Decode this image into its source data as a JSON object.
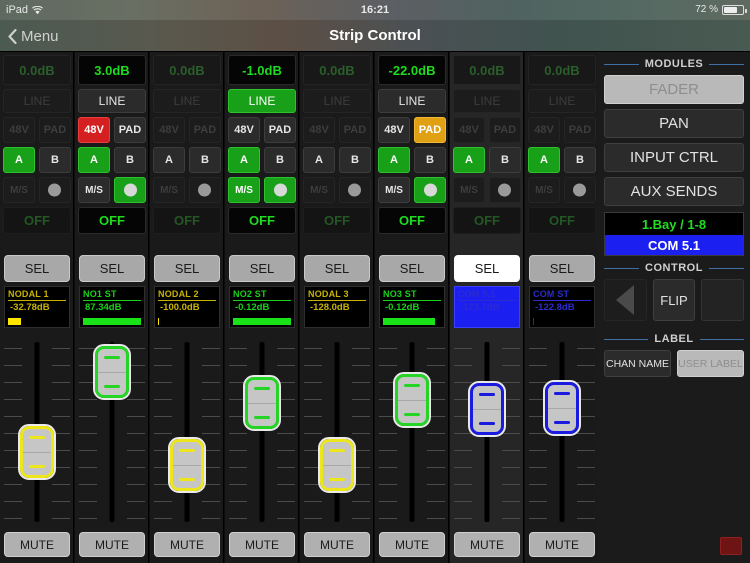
{
  "statusbar": {
    "device": "iPad",
    "wifi_icon": "wifi-icon",
    "time": "16:21",
    "battery_percent": "72 %",
    "battery_icon": "battery-icon"
  },
  "navbar": {
    "back_label": "Menu",
    "back_icon": "chevron-left-icon",
    "title": "Strip Control"
  },
  "strips": [
    {
      "gain": "0.0dB",
      "gain_state": "dim",
      "line_label": "LINE",
      "line_state": "dim",
      "p48_label": "48V",
      "p48_state": "dim",
      "pad_label": "PAD",
      "pad_state": "dim",
      "a_label": "A",
      "a_state": "green",
      "b_label": "B",
      "b_state": "normal",
      "ms_label": "M/S",
      "ms_state": "dim",
      "toggle_state": "off",
      "off_label": "OFF",
      "off_state": "dim",
      "sel_label": "SEL",
      "sel_state": "normal",
      "name": "NODAL 1",
      "level": "-32.78dB",
      "name_color": "#c8b400",
      "meter_color": "#ffe400",
      "meter_pct": 22,
      "bg_state": "normal",
      "fader_color": "yel",
      "fader_pos_pct": 66,
      "mute_label": "MUTE"
    },
    {
      "gain": "3.0dB",
      "gain_state": "normal",
      "line_label": "LINE",
      "line_state": "normal",
      "p48_label": "48V",
      "p48_state": "red",
      "pad_label": "PAD",
      "pad_state": "normal",
      "a_label": "A",
      "a_state": "green",
      "b_label": "B",
      "b_state": "normal",
      "ms_label": "M/S",
      "ms_state": "normal",
      "toggle_state": "on",
      "off_label": "OFF",
      "off_state": "normal",
      "sel_label": "SEL",
      "sel_state": "normal",
      "name": "NO1 ST",
      "level": "87.34dB",
      "name_color": "#19d219",
      "meter_color": "#19e219",
      "meter_pct": 100,
      "bg_state": "normal",
      "fader_color": "grn",
      "fader_pos_pct": 3,
      "mute_label": "MUTE"
    },
    {
      "gain": "0.0dB",
      "gain_state": "dim",
      "line_label": "LINE",
      "line_state": "dim",
      "p48_label": "48V",
      "p48_state": "dim",
      "pad_label": "PAD",
      "pad_state": "dim",
      "a_label": "A",
      "a_state": "normal",
      "b_label": "B",
      "b_state": "normal",
      "ms_label": "M/S",
      "ms_state": "dim",
      "toggle_state": "off",
      "off_label": "OFF",
      "off_state": "dim",
      "sel_label": "SEL",
      "sel_state": "normal",
      "name": "NODAL 2",
      "level": "-100.0dB",
      "name_color": "#c8b400",
      "meter_color": "#ffe400",
      "meter_pct": 2,
      "bg_state": "normal",
      "fader_color": "yel",
      "fader_pos_pct": 76,
      "mute_label": "MUTE"
    },
    {
      "gain": "-1.0dB",
      "gain_state": "normal",
      "line_label": "LINE",
      "line_state": "on",
      "p48_label": "48V",
      "p48_state": "normal",
      "pad_label": "PAD",
      "pad_state": "normal",
      "a_label": "A",
      "a_state": "green",
      "b_label": "B",
      "b_state": "normal",
      "ms_label": "M/S",
      "ms_state": "green",
      "toggle_state": "on",
      "off_label": "OFF",
      "off_state": "normal",
      "sel_label": "SEL",
      "sel_state": "normal",
      "name": "NO2 ST",
      "level": "-0.12dB",
      "name_color": "#19d219",
      "meter_color": "#19e219",
      "meter_pct": 100,
      "bg_state": "normal",
      "fader_color": "grn",
      "fader_pos_pct": 27,
      "mute_label": "MUTE"
    },
    {
      "gain": "0.0dB",
      "gain_state": "dim",
      "line_label": "LINE",
      "line_state": "dim",
      "p48_label": "48V",
      "p48_state": "dim",
      "pad_label": "PAD",
      "pad_state": "dim",
      "a_label": "A",
      "a_state": "normal",
      "b_label": "B",
      "b_state": "normal",
      "ms_label": "M/S",
      "ms_state": "dim",
      "toggle_state": "off",
      "off_label": "OFF",
      "off_state": "dim",
      "sel_label": "SEL",
      "sel_state": "normal",
      "name": "NODAL 3",
      "level": "-128.0dB",
      "name_color": "#c8b400",
      "meter_color": "#ffe400",
      "meter_pct": 0,
      "bg_state": "normal",
      "fader_color": "yel",
      "fader_pos_pct": 76,
      "mute_label": "MUTE"
    },
    {
      "gain": "-22.0dB",
      "gain_state": "normal",
      "line_label": "LINE",
      "line_state": "normal",
      "p48_label": "48V",
      "p48_state": "normal",
      "pad_label": "PAD",
      "pad_state": "amber",
      "a_label": "A",
      "a_state": "green",
      "b_label": "B",
      "b_state": "normal",
      "ms_label": "M/S",
      "ms_state": "normal",
      "toggle_state": "on",
      "off_label": "OFF",
      "off_state": "normal",
      "sel_label": "SEL",
      "sel_state": "normal",
      "name": "NO3 ST",
      "level": "-0.12dB",
      "name_color": "#19d219",
      "meter_color": "#19e219",
      "meter_pct": 90,
      "bg_state": "normal",
      "fader_color": "grn",
      "fader_pos_pct": 25,
      "mute_label": "MUTE"
    },
    {
      "gain": "0.0dB",
      "gain_state": "dim",
      "line_label": "LINE",
      "line_state": "dim",
      "p48_label": "48V",
      "p48_state": "dim",
      "pad_label": "PAD",
      "pad_state": "dim",
      "a_label": "A",
      "a_state": "green",
      "b_label": "B",
      "b_state": "normal",
      "ms_label": "M/S",
      "ms_state": "dim",
      "toggle_state": "off",
      "off_label": "OFF",
      "off_state": "dim",
      "sel_label": "SEL",
      "sel_state": "white",
      "name": "COM 5.1",
      "level": "-123.7dB",
      "name_color": "#2b2bcf",
      "meter_color": "#1b20f0",
      "meter_pct": 0,
      "bg_state": "selected",
      "fader_color": "blu",
      "fader_pos_pct": 32,
      "mute_label": "MUTE"
    },
    {
      "gain": "0.0dB",
      "gain_state": "dim",
      "line_label": "LINE",
      "line_state": "dim",
      "p48_label": "48V",
      "p48_state": "dim",
      "pad_label": "PAD",
      "pad_state": "dim",
      "a_label": "A",
      "a_state": "green",
      "b_label": "B",
      "b_state": "normal",
      "ms_label": "M/S",
      "ms_state": "dim",
      "toggle_state": "off",
      "off_label": "OFF",
      "off_state": "dim",
      "sel_label": "SEL",
      "sel_state": "normal",
      "name": "COM ST",
      "level": "-122.8dB",
      "name_color": "#2b2bcf",
      "meter_color": "#1b20f0",
      "meter_pct": 2,
      "bg_state": "normal",
      "fader_color": "blu",
      "fader_pos_pct": 31,
      "mute_label": "MUTE"
    }
  ],
  "right_panel": {
    "modules_header": "MODULES",
    "modules": [
      {
        "label": "FADER",
        "state": "active"
      },
      {
        "label": "PAN",
        "state": "normal"
      },
      {
        "label": "INPUT CTRL",
        "state": "normal"
      },
      {
        "label": "AUX SENDS",
        "state": "normal"
      }
    ],
    "bay_label": "1.Bay / 1-8",
    "bay_channel": "COM 5.1",
    "control_header": "CONTROL",
    "prev_icon": "triangle-left-icon",
    "flip_label": "FLIP",
    "next_icon": "triangle-right-icon",
    "label_header": "LABEL",
    "chan_name_label": "CHAN NAME",
    "user_label_label": "USER LABEL",
    "rec_indicator": "record-indicator"
  },
  "colors": {
    "green": "#19a019",
    "red": "#d42020",
    "amber": "#e0a013",
    "blue": "#1b20f0",
    "yellow": "#ece61a",
    "accent_rule": "#3f6fa5"
  }
}
